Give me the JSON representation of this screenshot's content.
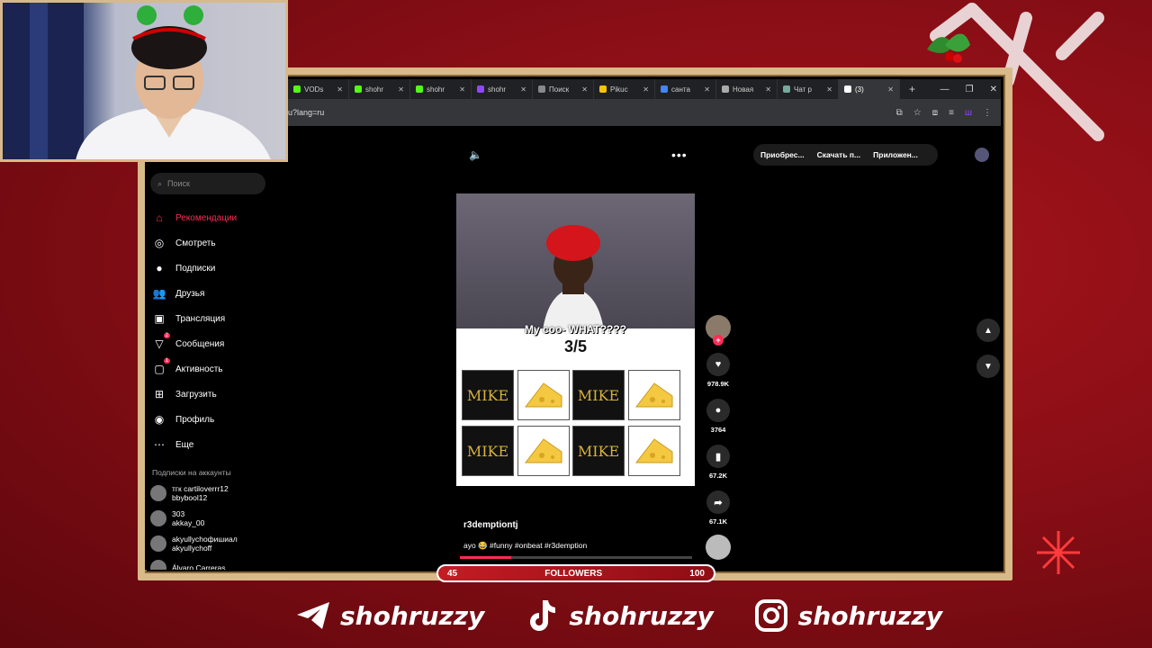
{
  "browser": {
    "tabs": [
      {
        "label": "VODs",
        "color": "#53fc18"
      },
      {
        "label": "shohr",
        "color": "#53fc18"
      },
      {
        "label": "shohr",
        "color": "#53fc18"
      },
      {
        "label": "shohr",
        "color": "#9146ff"
      },
      {
        "label": "Поиск",
        "color": "#888888"
      },
      {
        "label": "Pikuc",
        "color": "#f5c400"
      },
      {
        "label": "санта",
        "color": "#4285f4"
      },
      {
        "label": "Новая",
        "color": "#aaaaaa"
      },
      {
        "label": "Чат р",
        "color": "#74aa9c"
      },
      {
        "label": "(3)",
        "color": "#ffffff"
      }
    ],
    "url": "u?lang=ru"
  },
  "sidebar": {
    "search_placeholder": "Поиск",
    "items": [
      {
        "label": "Рекомендации",
        "icon": "home-icon",
        "glyph": "⌂"
      },
      {
        "label": "Смотреть",
        "icon": "compass-icon",
        "glyph": "◎"
      },
      {
        "label": "Подписки",
        "icon": "following-icon",
        "glyph": "●"
      },
      {
        "label": "Друзья",
        "icon": "friends-icon",
        "glyph": "👥"
      },
      {
        "label": "Трансляция",
        "icon": "live-icon",
        "glyph": "▣"
      },
      {
        "label": "Сообщения",
        "icon": "messages-icon",
        "glyph": "▽",
        "badge": "2"
      },
      {
        "label": "Активность",
        "icon": "activity-icon",
        "glyph": "▢",
        "badge": "1"
      },
      {
        "label": "Загрузить",
        "icon": "upload-icon",
        "glyph": "⊞"
      },
      {
        "label": "Профиль",
        "icon": "profile-icon",
        "glyph": "◉"
      },
      {
        "label": "Еще",
        "icon": "more-icon",
        "glyph": "⋯"
      }
    ],
    "following_header": "Подписки на аккаунты",
    "accounts": [
      {
        "name": "тгк cartiloverrr12",
        "handle": "bbybool12"
      },
      {
        "name": "303",
        "handle": "akkay_00"
      },
      {
        "name": "akyullychoфишиал",
        "handle": "akyullychoff"
      },
      {
        "name": "Álvaro Carreras",
        "handle": ""
      }
    ]
  },
  "topbar": {
    "buttons": [
      "Приобрес...",
      "Скачать п...",
      "Приложен..."
    ]
  },
  "video": {
    "caption": "My coo- WHAT????",
    "score": "3/5",
    "cards": [
      "MIKE",
      "cheese",
      "MIKE",
      "cheese",
      "MIKE",
      "cheese",
      "MIKE",
      "cheese"
    ],
    "author": "r3demptiontj",
    "description": "ayo 😂 #funny #onbeat #r3demption",
    "progress": 0.22
  },
  "actions": {
    "likes": "978.9K",
    "comments": "3764",
    "saves": "67.2K",
    "shares": "67.1K"
  },
  "followers_bar": {
    "current": "45",
    "label": "FOLLOWERS",
    "goal": "100"
  },
  "socials": [
    {
      "icon": "telegram-icon",
      "handle": "shohruzzy"
    },
    {
      "icon": "tiktok-icon",
      "handle": "shohruzzy"
    },
    {
      "icon": "instagram-icon",
      "handle": "shohruzzy"
    }
  ]
}
